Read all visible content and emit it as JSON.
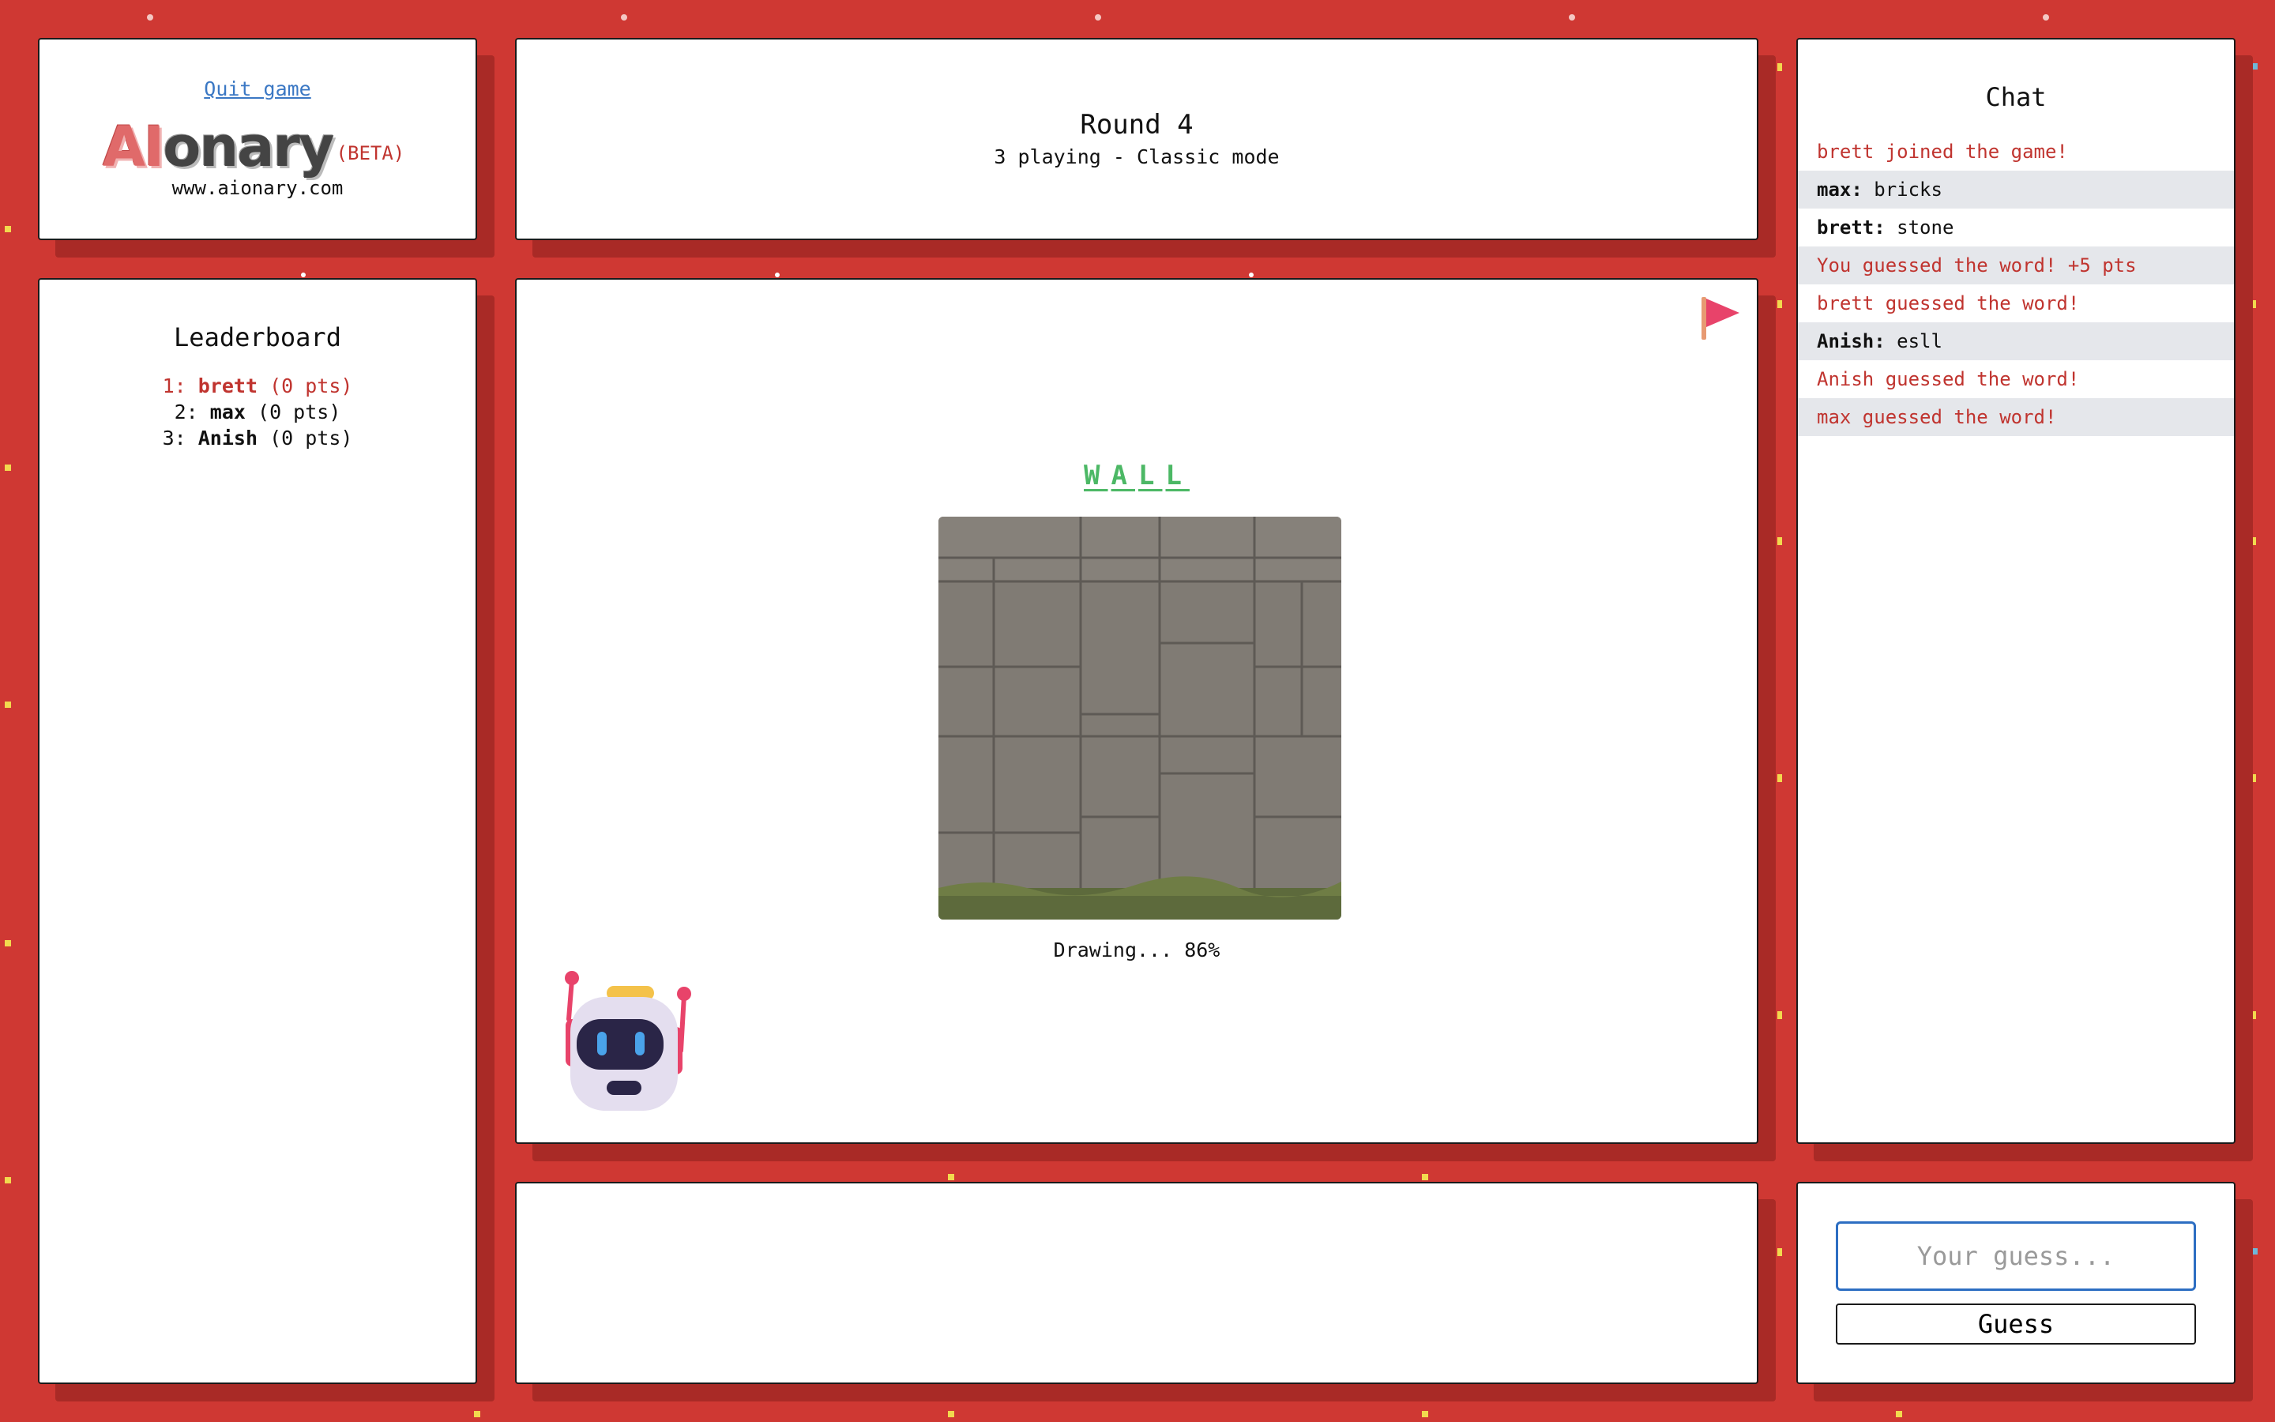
{
  "header": {
    "quit_label": "Quit game",
    "logo_ai": "AI",
    "logo_rest": "onary",
    "beta": "(BETA)",
    "site": "www.aionary.com"
  },
  "round": {
    "title": "Round 4",
    "subtitle": "3 playing - Classic mode"
  },
  "leaderboard": {
    "title": "Leaderboard",
    "rows": [
      {
        "rank": "1:",
        "name": "brett",
        "pts": "(0 pts)"
      },
      {
        "rank": "2:",
        "name": "max",
        "pts": "(0 pts)"
      },
      {
        "rank": "3:",
        "name": "Anish",
        "pts": "(0 pts)"
      }
    ]
  },
  "game": {
    "word_letters": [
      "W",
      "A",
      "L",
      "L"
    ],
    "progress_text": "Drawing... 86%",
    "progress_percent": 86
  },
  "chat": {
    "title": "Chat",
    "messages": [
      {
        "text": "brett joined the game!"
      },
      {
        "who": "max:",
        "text": " bricks"
      },
      {
        "who": "brett:",
        "text": " stone"
      },
      {
        "text": "You guessed the word! +5 pts"
      },
      {
        "text": "brett guessed the word!"
      },
      {
        "who": "Anish:",
        "text": " esll"
      },
      {
        "text": "Anish guessed the word!"
      },
      {
        "text": "max guessed the word!"
      }
    ]
  },
  "guess": {
    "placeholder": "Your guess...",
    "button_label": "Guess"
  },
  "colors": {
    "background": "#cf3833",
    "accent_red": "#c0342f",
    "word_green": "#4cb865",
    "link_blue": "#3b78c4"
  },
  "icons": {
    "flag": "report-flag-icon",
    "robot": "robot-mascot-icon"
  }
}
